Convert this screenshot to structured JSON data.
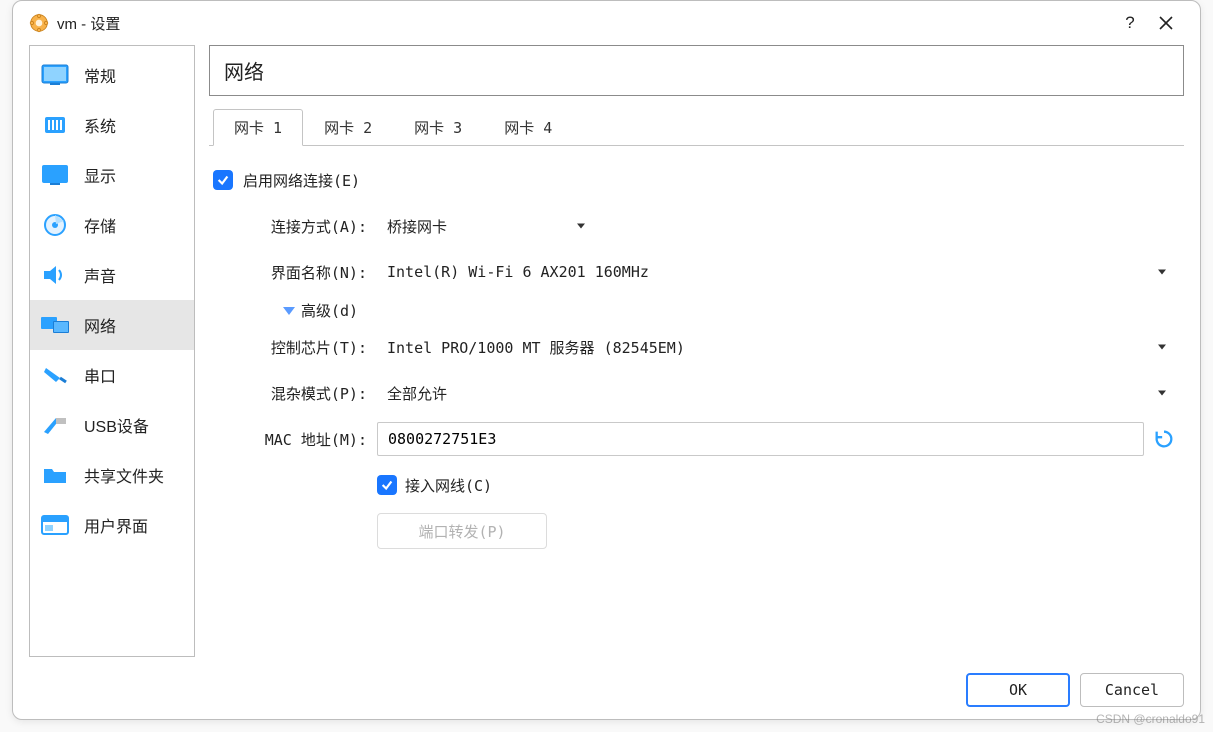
{
  "title": "vm - 设置",
  "titlebar": {
    "help": "?",
    "close": "✕"
  },
  "sidebar": {
    "items": [
      {
        "key": "general",
        "label": "常规"
      },
      {
        "key": "system",
        "label": "系统"
      },
      {
        "key": "display",
        "label": "显示"
      },
      {
        "key": "storage",
        "label": "存储"
      },
      {
        "key": "audio",
        "label": "声音"
      },
      {
        "key": "network",
        "label": "网络"
      },
      {
        "key": "serial",
        "label": "串口"
      },
      {
        "key": "usb",
        "label": "USB设备"
      },
      {
        "key": "shared",
        "label": "共享文件夹"
      },
      {
        "key": "ui",
        "label": "用户界面"
      }
    ],
    "selected": "network"
  },
  "section_title": "网络",
  "tabs": [
    {
      "label": "网卡 1",
      "active": true
    },
    {
      "label": "网卡 2",
      "active": false
    },
    {
      "label": "网卡 3",
      "active": false
    },
    {
      "label": "网卡 4",
      "active": false
    }
  ],
  "form": {
    "enable_label": "启用网络连接(E)",
    "enable_checked": true,
    "attached_label": "连接方式(A):",
    "attached_value": "桥接网卡",
    "name_label": "界面名称(N):",
    "name_value": "Intel(R) Wi-Fi 6 AX201 160MHz",
    "advanced_label": "高级(d)",
    "adapter_type_label": "控制芯片(T):",
    "adapter_type_value": "Intel PRO/1000 MT 服务器 (82545EM)",
    "promisc_label": "混杂模式(P):",
    "promisc_value": "全部允许",
    "mac_label": "MAC 地址(M):",
    "mac_value": "0800272751E3",
    "cable_label": "接入网线(C)",
    "cable_checked": true,
    "port_fwd_label": "端口转发(P)"
  },
  "buttons": {
    "ok": "OK",
    "cancel": "Cancel"
  },
  "watermark": "CSDN @cronaldo91"
}
